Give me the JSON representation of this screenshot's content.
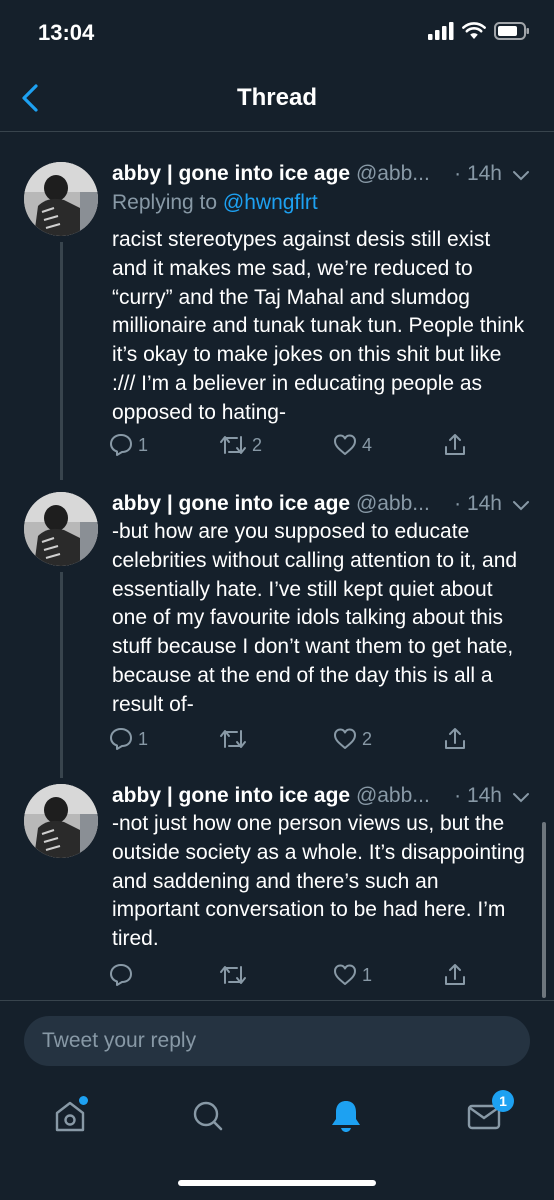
{
  "status": {
    "time": "13:04"
  },
  "nav": {
    "title": "Thread"
  },
  "tweets": [
    {
      "name": "abby | gone into ice age",
      "handle": "@abb...",
      "time": "· 14h",
      "replying_prefix": "Replying to ",
      "replying_to": "@hwngflrt",
      "text": "racist stereotypes against desis still exist and it makes me sad, we’re reduced to “curry” and the Taj Mahal and slumdog millionaire and tunak tunak tun. People think it’s okay to make jokes on this shit but like :/// I’m a believer in educating people as opposed to hating-",
      "replies": "1",
      "retweets": "2",
      "likes": "4"
    },
    {
      "name": "abby | gone into ice age",
      "handle": "@abb...",
      "time": "· 14h",
      "text": "-but how are you supposed to educate celebrities without calling attention to it, and essentially hate. I’ve still kept quiet about one of my favourite idols talking about this stuff because I don’t want them to get hate, because at the end of the day this is all a result of-",
      "replies": "1",
      "retweets": "",
      "likes": "2"
    },
    {
      "name": "abby | gone into ice age",
      "handle": "@abb...",
      "time": "· 14h",
      "text": "-not just how one person views us, but the outside society as a whole. It’s disappointing and saddening and there’s such an important conversation to be had here. I’m tired.",
      "replies": "",
      "retweets": "",
      "likes": "1"
    }
  ],
  "reply": {
    "placeholder": "Tweet your reply"
  },
  "tabs": {
    "notifications_badge": "1"
  },
  "colors": {
    "background": "#15202b",
    "accent": "#1da1f2",
    "muted": "#8899a6"
  }
}
